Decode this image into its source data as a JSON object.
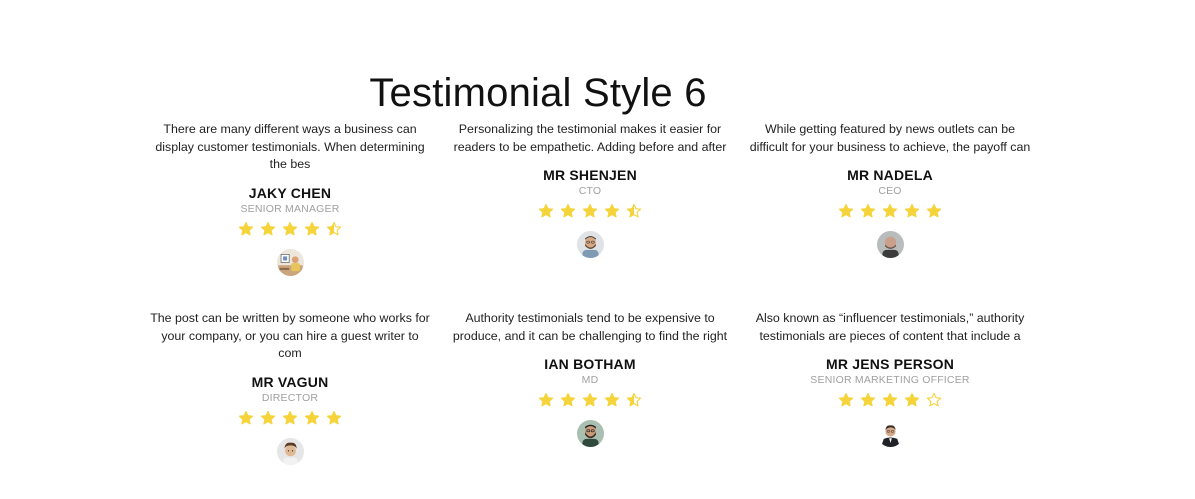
{
  "page": {
    "title": "Testimonial Style 6"
  },
  "colors": {
    "star": "#f5d33a",
    "star_empty_stroke": "#f5d33a",
    "role_text": "#a0a0a0"
  },
  "testimonials": [
    {
      "quote": "There are many different ways a business can display customer testimonials. When determining the bes",
      "name": "JAKY CHEN",
      "role": "SENIOR MANAGER",
      "rating": 4.5,
      "avatar": "avatar-desk-workspace"
    },
    {
      "quote": "Personalizing the testimonial makes it easier for readers to be empathetic. Adding before and after",
      "name": "MR SHENJEN",
      "role": "CTO",
      "rating": 4.5,
      "avatar": "avatar-bearded-man"
    },
    {
      "quote": "While getting featured by news outlets can be difficult for your business to achieve, the payoff can",
      "name": "MR NADELA",
      "role": "CEO",
      "rating": 5,
      "avatar": "avatar-bald-man"
    },
    {
      "quote": "The post can be written by someone who works for your company, or you can hire a guest writer to com",
      "name": "MR VAGUN",
      "role": "DIRECTOR",
      "rating": 5,
      "avatar": "avatar-curly-hair-man"
    },
    {
      "quote": "Authority testimonials tend to be expensive to produce, and it can be challenging to find the right",
      "name": "IAN BOTHAM",
      "role": "MD",
      "rating": 4.5,
      "avatar": "avatar-bearded-man-green"
    },
    {
      "quote": "Also known as “influencer testimonials,” authority testimonials are pieces of content that include a",
      "name": "MR JENS PERSON",
      "role": "SENIOR MARKETING OFFICER",
      "rating": 4,
      "avatar": "avatar-man-in-suit"
    }
  ]
}
